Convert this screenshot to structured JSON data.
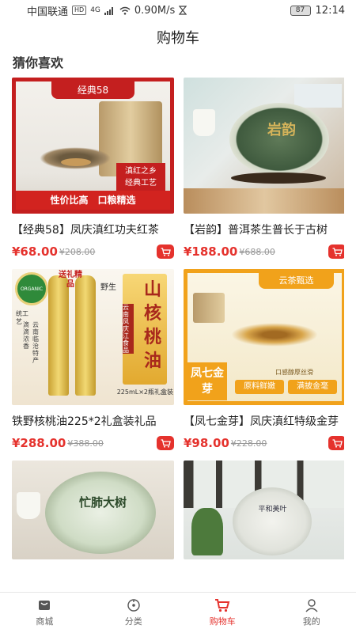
{
  "status_bar": {
    "carrier": "中国联通",
    "hd": "HD",
    "signal": "4G",
    "speed": "0.90M/s",
    "battery": "87",
    "time": "12:14"
  },
  "header": {
    "title": "购物车"
  },
  "section": {
    "title": "猜你喜欢"
  },
  "products": [
    {
      "name": "【经典58】凤庆滇红功夫红茶",
      "price": "¥68.00",
      "original_price": "¥208.00",
      "image_text": {
        "tag": "经典58",
        "banner": "性价比高　口粮精选",
        "stamp_line1": "滇红之乡",
        "stamp_line2": "经典工艺"
      }
    },
    {
      "name": "【岩韵】普洱茶生普长于古树",
      "price": "¥188.00",
      "original_price": "¥688.00",
      "image_text": {
        "label": "岩韵"
      }
    },
    {
      "name": "铁野核桃油225*2礼盒装礼品",
      "price": "¥288.00",
      "original_price": "¥388.00",
      "image_text": {
        "gift": "送礼精品",
        "wild": "野生",
        "big": "山核桃油",
        "side": "云南凤庆江食品",
        "left1": "统工艺",
        "left2": "云南临沧特产",
        "left3": "滴滴浓香",
        "bottom": "225mL×2瓶礼盒装",
        "badge": "ORGANIC"
      }
    },
    {
      "name": "【凤七金芽】凤庆滇红特级金芽",
      "price": "¥98.00",
      "original_price": "¥228.00",
      "image_text": {
        "top": "云茶甄选",
        "left": "凤七金芽",
        "chip1": "原料鲜嫩",
        "chip2": "满披金毫",
        "note": "口感醇厚丝滑"
      }
    },
    {
      "name": "",
      "price": "",
      "original_price": "",
      "image_text": {
        "cake": "忙肺大树"
      }
    },
    {
      "name": "",
      "price": "",
      "original_price": "",
      "image_text": {
        "cake": "平和美叶"
      }
    }
  ],
  "tabs": [
    {
      "label": "商城",
      "icon": "mall-icon",
      "active": false
    },
    {
      "label": "分类",
      "icon": "category-icon",
      "active": false
    },
    {
      "label": "购物车",
      "icon": "cart-icon",
      "active": true
    },
    {
      "label": "我的",
      "icon": "profile-icon",
      "active": false
    }
  ],
  "colors": {
    "accent": "#e5322d",
    "text": "#222222",
    "muted": "#999999"
  }
}
